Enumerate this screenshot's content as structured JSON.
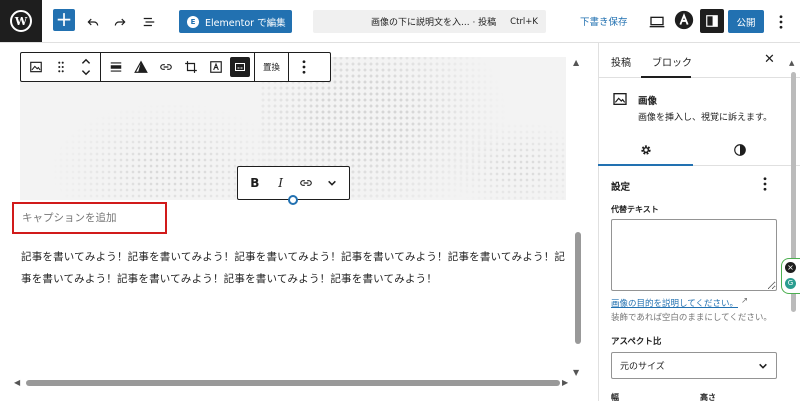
{
  "topbar": {
    "add_block": "+",
    "elementor_badge": "E",
    "elementor_label": "Elementor で編集",
    "doc_title": "画像の下に説明文を入... · 投稿",
    "doc_shortcut": "Ctrl+K",
    "save_draft": "下書き保存",
    "publish": "公開"
  },
  "block_toolbar": {
    "replace": "置換"
  },
  "caption_toolbar": {
    "bold": "B",
    "italic": "I"
  },
  "editor": {
    "caption_placeholder": "キャプションを追加",
    "paragraph": "記事を書いてみよう！記事を書いてみよう！記事を書いてみよう！記事を書いてみよう！記事を書いてみよう！記事を書いてみよう！記事を書いてみよう！記事を書いてみよう！記事を書いてみよう！"
  },
  "sidebar": {
    "tabs": [
      {
        "label": "投稿"
      },
      {
        "label": "ブロック"
      }
    ],
    "block": {
      "name": "画像",
      "description": "画像を挿入し、視覚に訴えます。"
    },
    "settings": {
      "title": "設定",
      "alt_label": "代替テキスト",
      "alt_value": "",
      "alt_link": "画像の目的を説明してください。",
      "alt_link_ext": "↗",
      "alt_help": "装飾であれば空白のままにしてください。",
      "aspect_label": "アスペクト比",
      "aspect_value": "元のサイズ",
      "width_label": "幅",
      "height_label": "高さ"
    }
  },
  "extension": {
    "close": "×",
    "logo": "G"
  },
  "colors": {
    "accent": "#2271b1",
    "highlight_box": "#d11a1a",
    "toolbar_dark": "#1e1e1e"
  }
}
